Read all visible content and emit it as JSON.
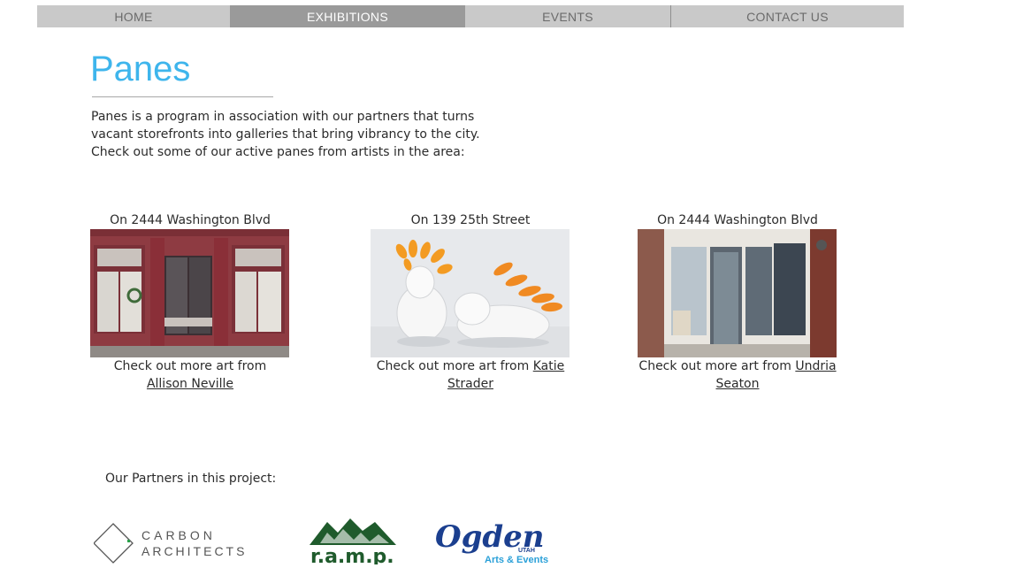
{
  "nav": {
    "items": [
      {
        "label": "HOME"
      },
      {
        "label": "EXHIBITIONS",
        "active": true
      },
      {
        "label": "EVENTS"
      },
      {
        "label": "CONTACT US"
      }
    ]
  },
  "page": {
    "title": "Panes",
    "intro_lines": [
      "Panes is a program in association with our partners that turns",
      "vacant storefronts into galleries that bring vibrancy to the city.",
      "Check out some of our active panes from artists in the area:"
    ]
  },
  "panes": [
    {
      "location": "On 2444 Washington Blvd",
      "more_prefix": "Check out more art from",
      "artist": "Allison Neville"
    },
    {
      "location": "On 139 25th Street",
      "more_prefix": "Check out more art from",
      "artist": "Katie Strader"
    },
    {
      "location": "On 2444 Washington Blvd",
      "more_prefix": "Check out more art from",
      "artist": "Undria Seaton"
    }
  ],
  "partners": {
    "label": "Our Partners in this project:",
    "carbon": {
      "line1": "CARBON",
      "line2": "ARCHITECTS"
    },
    "ramp": {
      "text": "r.a.m.p."
    },
    "ogden": {
      "text": "Ogden",
      "state": "UTAH",
      "sub": "Arts & Events"
    }
  },
  "colors": {
    "accent": "#3eb5ec",
    "nav_bg": "#c9c9c9",
    "nav_active": "#9a9a9a",
    "ramp_green": "#1f5b2c",
    "ogden_blue": "#1b3f8f"
  }
}
